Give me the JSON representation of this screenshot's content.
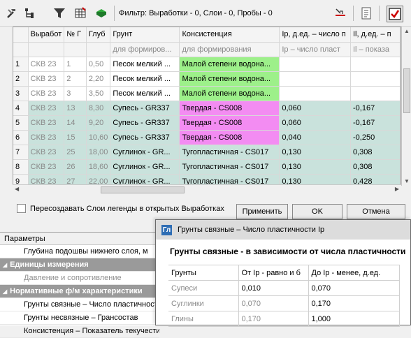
{
  "toolbar": {
    "icons": [
      "hammer-icon",
      "tree-icon",
      "funnel-icon",
      "table-icon",
      "book-icon",
      "cursor-arrows-icon",
      "page-icon",
      "checkbox-icon"
    ],
    "filter_text": "Фильтр: Выработки - 0, Слои - 0, Пробы - 0"
  },
  "grid": {
    "headers": [
      "Выработ",
      "№ Г",
      "Глуб",
      "Грунт",
      "Консистенция",
      "Ip, д.ед. – число п",
      "Il, д.ед. – п"
    ],
    "subheaders": [
      "",
      "",
      "",
      "для формиров...",
      "для формирования",
      "Ip – число пласт",
      "Il – показа"
    ],
    "rows": [
      {
        "n": "1",
        "well": "СКВ 23",
        "num": "1",
        "depth": "0,50",
        "soil": "Песок мелкий ...",
        "cons": "Малой степени водона...",
        "ip": "",
        "il": ""
      },
      {
        "n": "2",
        "well": "СКВ 23",
        "num": "2",
        "depth": "2,20",
        "soil": "Песок мелкий ...",
        "cons": "Малой степени водона...",
        "ip": "",
        "il": ""
      },
      {
        "n": "3",
        "well": "СКВ 23",
        "num": "3",
        "depth": "3,50",
        "soil": "Песок мелкий ...",
        "cons": "Малой степени водона...",
        "ip": "",
        "il": ""
      },
      {
        "n": "4",
        "well": "СКВ 23",
        "num": "13",
        "depth": "8,30",
        "soil": "Супесь - GR337",
        "cons": "Твердая - CS008",
        "ip": "0,060",
        "il": "-0,167"
      },
      {
        "n": "5",
        "well": "СКВ 23",
        "num": "14",
        "depth": "9,20",
        "soil": "Супесь - GR337",
        "cons": "Твердая - CS008",
        "ip": "0,060",
        "il": "-0,167"
      },
      {
        "n": "6",
        "well": "СКВ 23",
        "num": "15",
        "depth": "10,60",
        "soil": "Супесь - GR337",
        "cons": "Твердая - CS008",
        "ip": "0,040",
        "il": "-0,250"
      },
      {
        "n": "7",
        "well": "СКВ 23",
        "num": "25",
        "depth": "18,00",
        "soil": "Суглинок - GR...",
        "cons": "Тугопластичная - CS017",
        "ip": "0,130",
        "il": "0,308"
      },
      {
        "n": "8",
        "well": "СКВ 23",
        "num": "26",
        "depth": "18,60",
        "soil": "Суглинок - GR...",
        "cons": "Тугопластичная - CS017",
        "ip": "0,130",
        "il": "0,308"
      },
      {
        "n": "9",
        "well": "СКВ 23",
        "num": "27",
        "depth": "22,00",
        "soil": "Суглинок - GR...",
        "cons": "Тугопластичная - CS017",
        "ip": "0,130",
        "il": "0,428"
      }
    ]
  },
  "controls": {
    "recreate_label": "Пересоздавать Слои легенды в открытых Выработках",
    "apply_label": "Применить",
    "ok_label": "OK",
    "cancel_label": "Отмена"
  },
  "params": {
    "header": "Параметры",
    "items": [
      {
        "text": "Глубина подошвы нижнего слоя, м",
        "kind": "ind"
      },
      {
        "text": "Единицы измерения",
        "kind": "cat"
      },
      {
        "text": "Давление и сопротивление",
        "kind": "ind-dis"
      },
      {
        "text": "Нормативные ф/м характеристики",
        "kind": "cat"
      },
      {
        "text": "Грунты связные – Число пластичности",
        "kind": "ind"
      },
      {
        "text": "Грунты несвязные – Грансостав",
        "kind": "ind"
      },
      {
        "text": "Консистенция – Показатель текучести",
        "kind": "ind"
      }
    ]
  },
  "dialog": {
    "app_icon": "Гл",
    "title": "Грунты связные – Число пластичности Ip",
    "heading": "Грунты связные - в зависимости от числа пластичности",
    "columns": [
      "Грунты",
      "От Ip - равно и б",
      "До Ip - менее, д.ед."
    ],
    "rows": [
      {
        "soil": "Супеси",
        "from": "0,010",
        "to": "0,070"
      },
      {
        "soil": "Суглинки",
        "from": "0,070",
        "to": "0,170"
      },
      {
        "soil": "Глины",
        "from": "0,170",
        "to": "1,000"
      }
    ]
  }
}
